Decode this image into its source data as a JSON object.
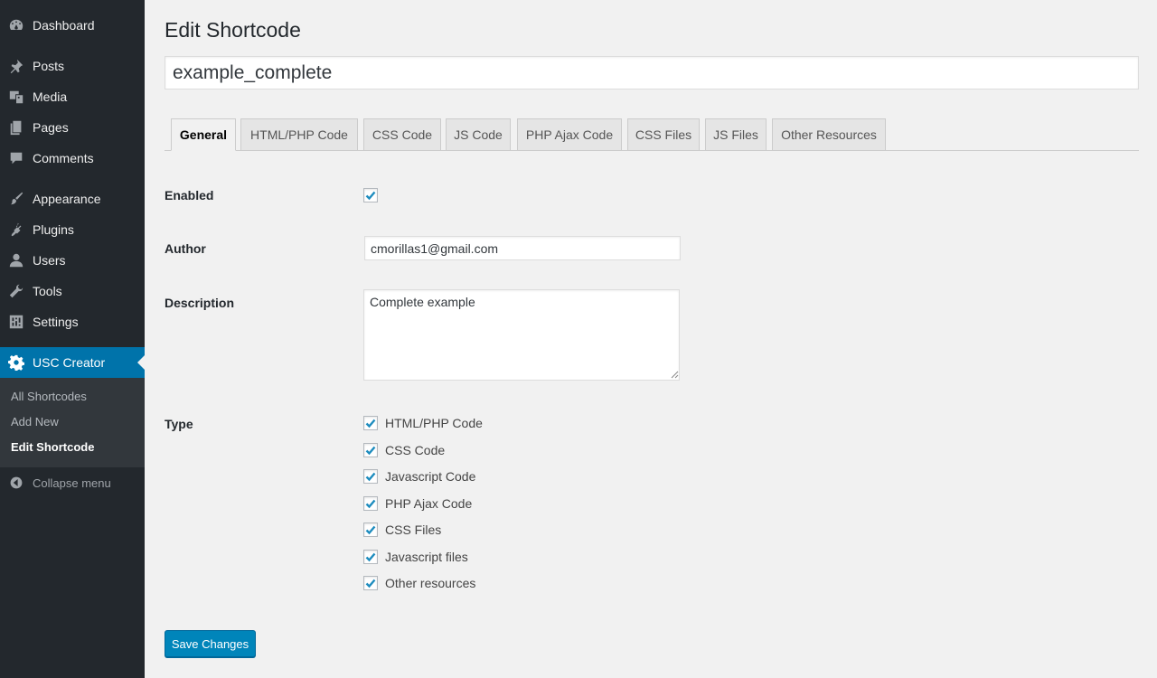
{
  "sidebar": {
    "items": [
      {
        "label": "Dashboard",
        "icon": "dashboard-icon"
      },
      {
        "label": "Posts",
        "icon": "pushpin-icon"
      },
      {
        "label": "Media",
        "icon": "media-icon"
      },
      {
        "label": "Pages",
        "icon": "pages-icon"
      },
      {
        "label": "Comments",
        "icon": "comment-icon"
      },
      {
        "label": "Appearance",
        "icon": "paintbrush-icon"
      },
      {
        "label": "Plugins",
        "icon": "plugin-icon"
      },
      {
        "label": "Users",
        "icon": "user-icon"
      },
      {
        "label": "Tools",
        "icon": "wrench-icon"
      },
      {
        "label": "Settings",
        "icon": "settings-icon"
      },
      {
        "label": "USC Creator",
        "icon": "gear-icon"
      }
    ],
    "submenu": [
      "All Shortcodes",
      "Add New",
      "Edit Shortcode"
    ],
    "collapse_label": "Collapse menu",
    "accent_color": "#0073aa",
    "background_color": "#23282d"
  },
  "page": {
    "title": "Edit Shortcode",
    "shortcode_name": "example_complete"
  },
  "tabs": [
    "General",
    "HTML/PHP Code",
    "CSS Code",
    "JS Code",
    "PHP Ajax Code",
    "CSS Files",
    "JS Files",
    "Other Resources"
  ],
  "active_tab": "General",
  "form": {
    "enabled_label": "Enabled",
    "enabled_checked": true,
    "author_label": "Author",
    "author_value": "cmorillas1@gmail.com",
    "description_label": "Description",
    "description_value": "Complete example",
    "type_label": "Type",
    "type_options": [
      {
        "label": "HTML/PHP Code",
        "checked": true
      },
      {
        "label": "CSS Code",
        "checked": true
      },
      {
        "label": "Javascript Code",
        "checked": true
      },
      {
        "label": "PHP Ajax Code",
        "checked": true
      },
      {
        "label": "CSS Files",
        "checked": true
      },
      {
        "label": "Javascript files",
        "checked": true
      },
      {
        "label": "Other resources",
        "checked": true
      }
    ],
    "save_label": "Save Changes",
    "button_color": "#0085ba"
  }
}
